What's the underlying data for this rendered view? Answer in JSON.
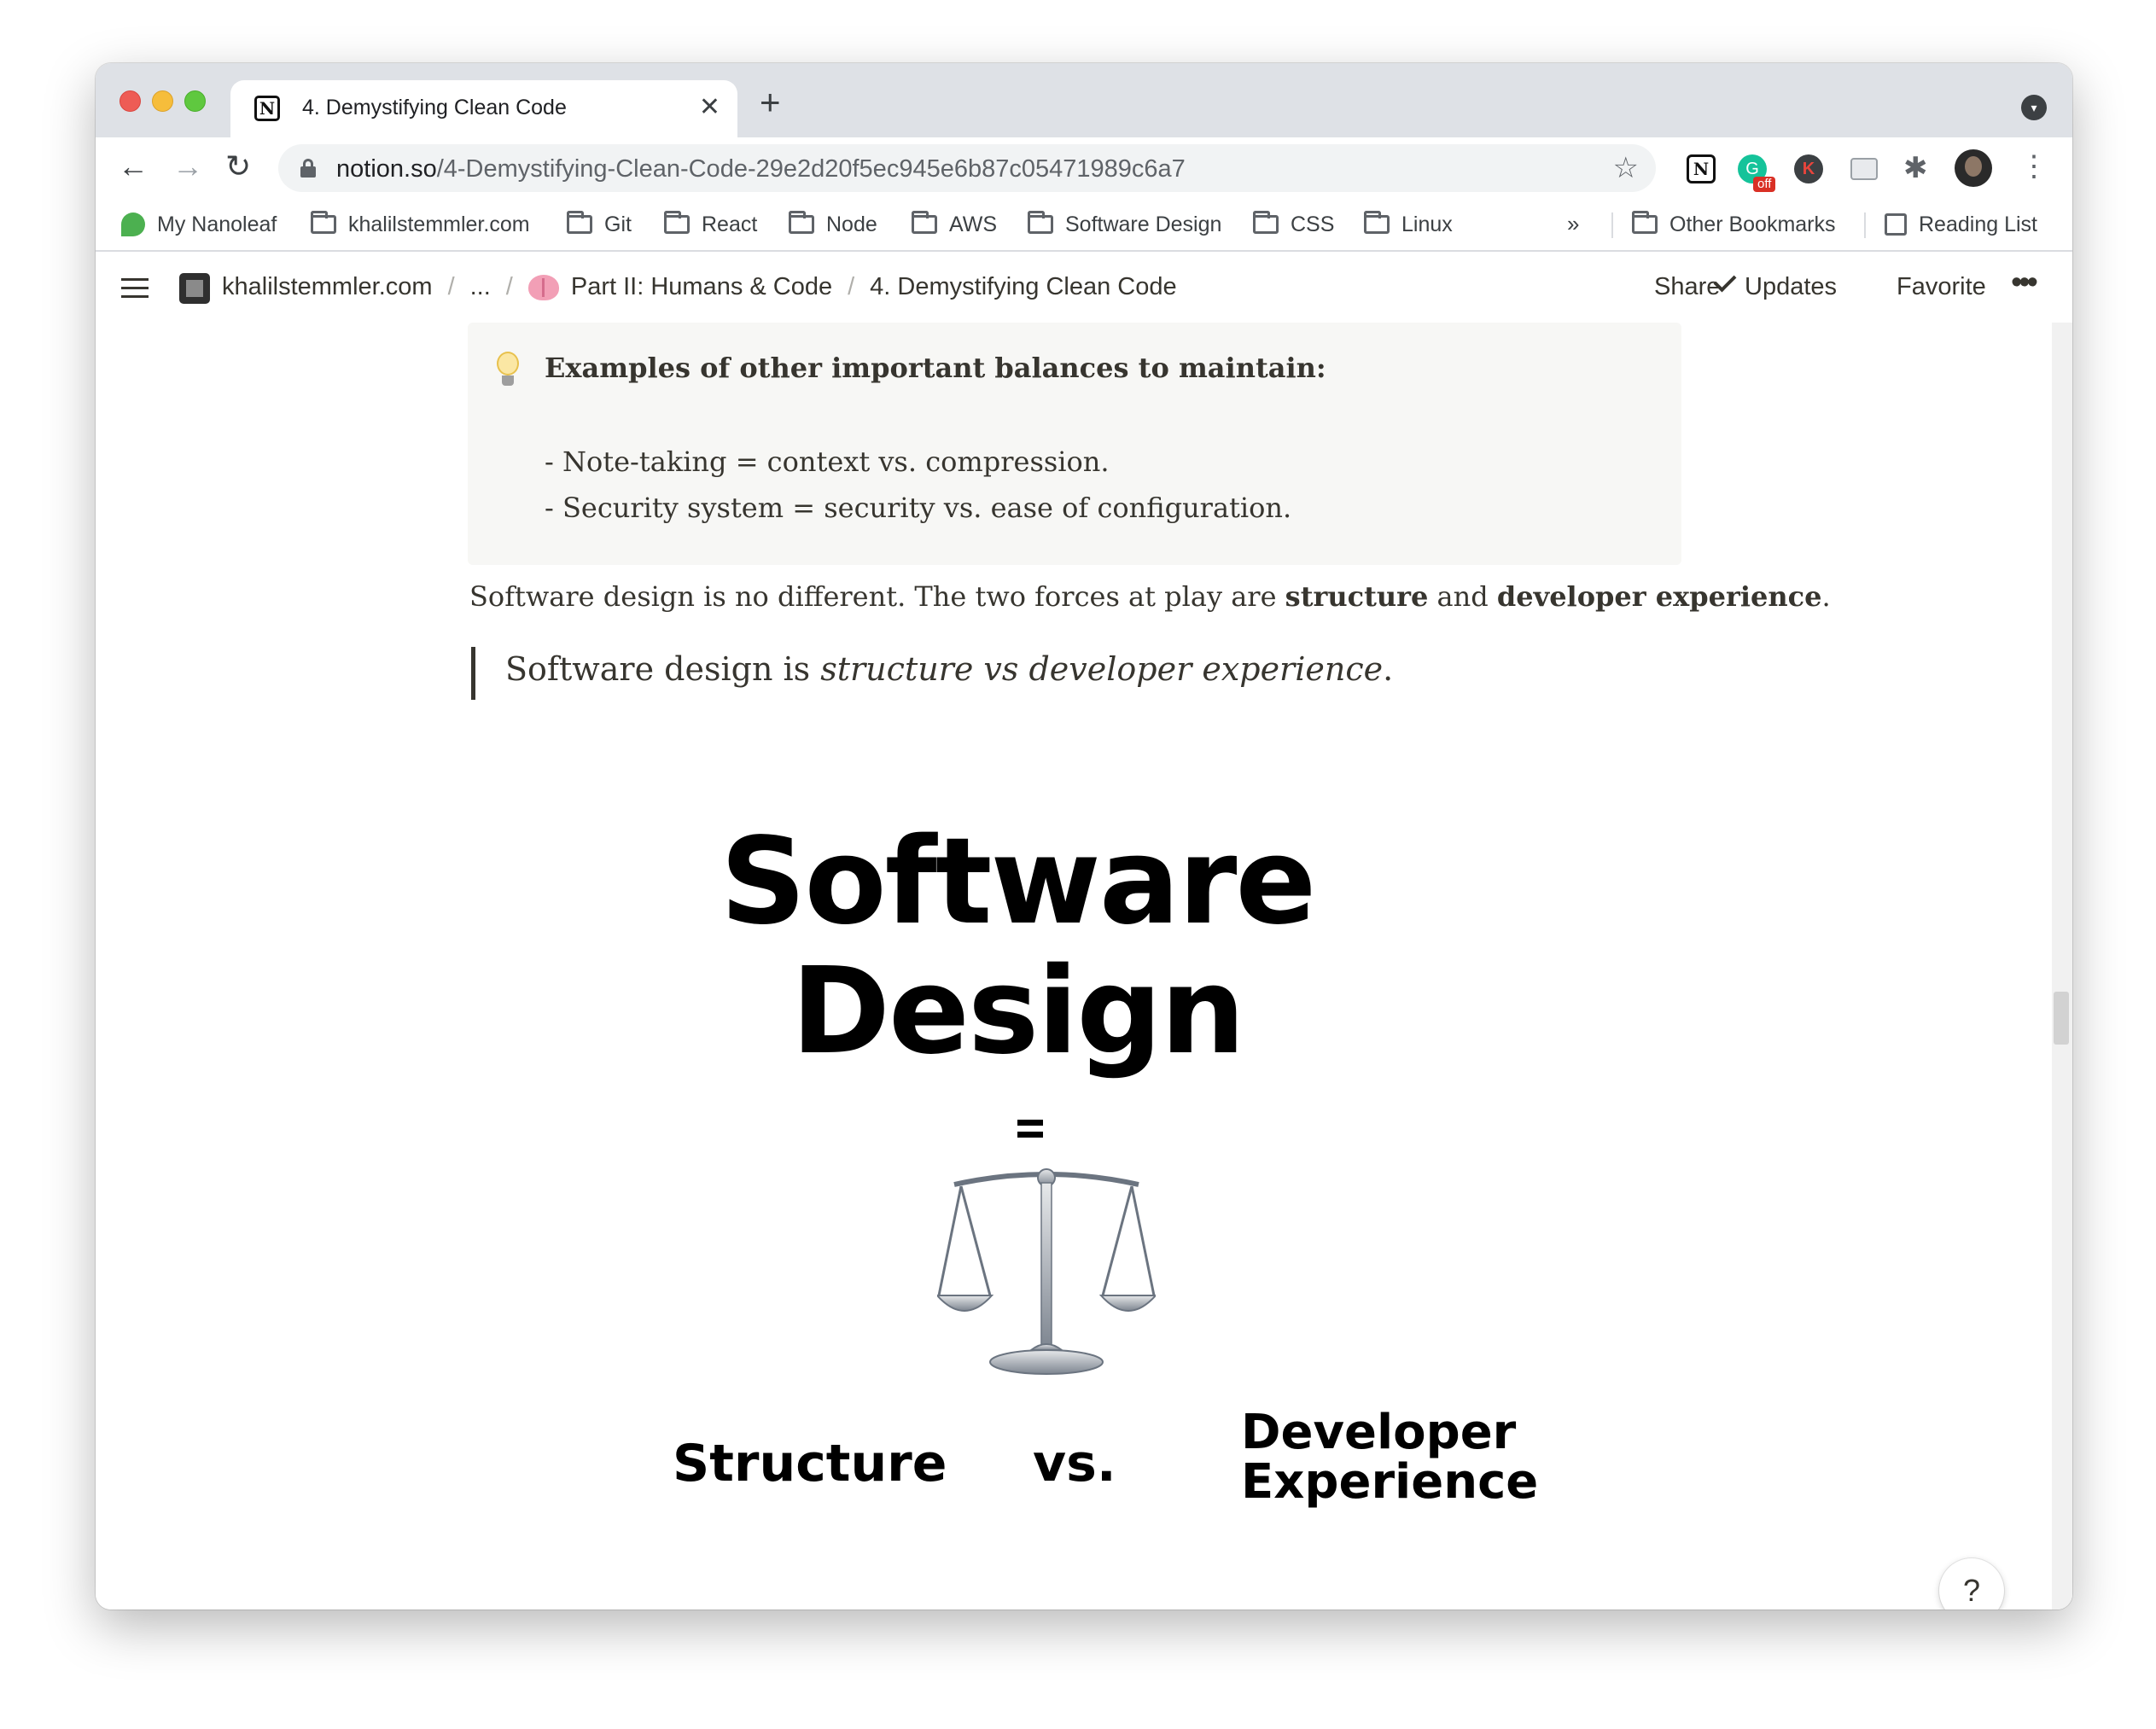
{
  "browser": {
    "tab": {
      "title": "4. Demystifying Clean Code",
      "favicon": "N",
      "close": "✕"
    },
    "new_tab": "+",
    "url_host": "notion.so",
    "url_path": "/4-Demystifying-Clean-Code-29e2d20f5ec945e6b87c05471989c6a7",
    "extensions": {
      "grammarly_badge": "off",
      "k_letter": "K",
      "notion_letter": "N"
    },
    "bookmarks": [
      {
        "label": "My Nanoleaf"
      },
      {
        "label": "khalilstemmler.com"
      },
      {
        "label": "Git"
      },
      {
        "label": "React"
      },
      {
        "label": "Node"
      },
      {
        "label": "AWS"
      },
      {
        "label": "Software Design"
      },
      {
        "label": "CSS"
      },
      {
        "label": "Linux"
      }
    ],
    "bookmarks_more": "»",
    "other_bookmarks": "Other Bookmarks",
    "reading_list": "Reading List"
  },
  "notion": {
    "breadcrumb": {
      "workspace": "khalilstemmler.com",
      "ellipsis": "...",
      "parent": "Part II: Humans & Code",
      "current": "4. Demystifying Clean Code",
      "separator": "/"
    },
    "actions": {
      "share": "Share",
      "updates": "Updates",
      "favorite": "Favorite",
      "more": "•••"
    }
  },
  "page": {
    "callout": {
      "title": "Examples of other important balances to maintain:",
      "lines": [
        "- Note-taking = context vs. compression.",
        "- Security system = security vs. ease of configuration."
      ]
    },
    "paragraph": {
      "before": "Software design is no different. The two forces at play are ",
      "bold1": "structure",
      "middle": " and ",
      "bold2": "developer experience",
      "after": "."
    },
    "quote": {
      "before": "Software design is ",
      "italic": "structure vs developer experience",
      "after": "."
    },
    "illustration": {
      "title_line1": "Software",
      "title_line2": "Design",
      "left_label": "Structure",
      "middle_label": "vs.",
      "right_label_line1": "Developer",
      "right_label_line2": "Experience"
    },
    "help": "?"
  }
}
